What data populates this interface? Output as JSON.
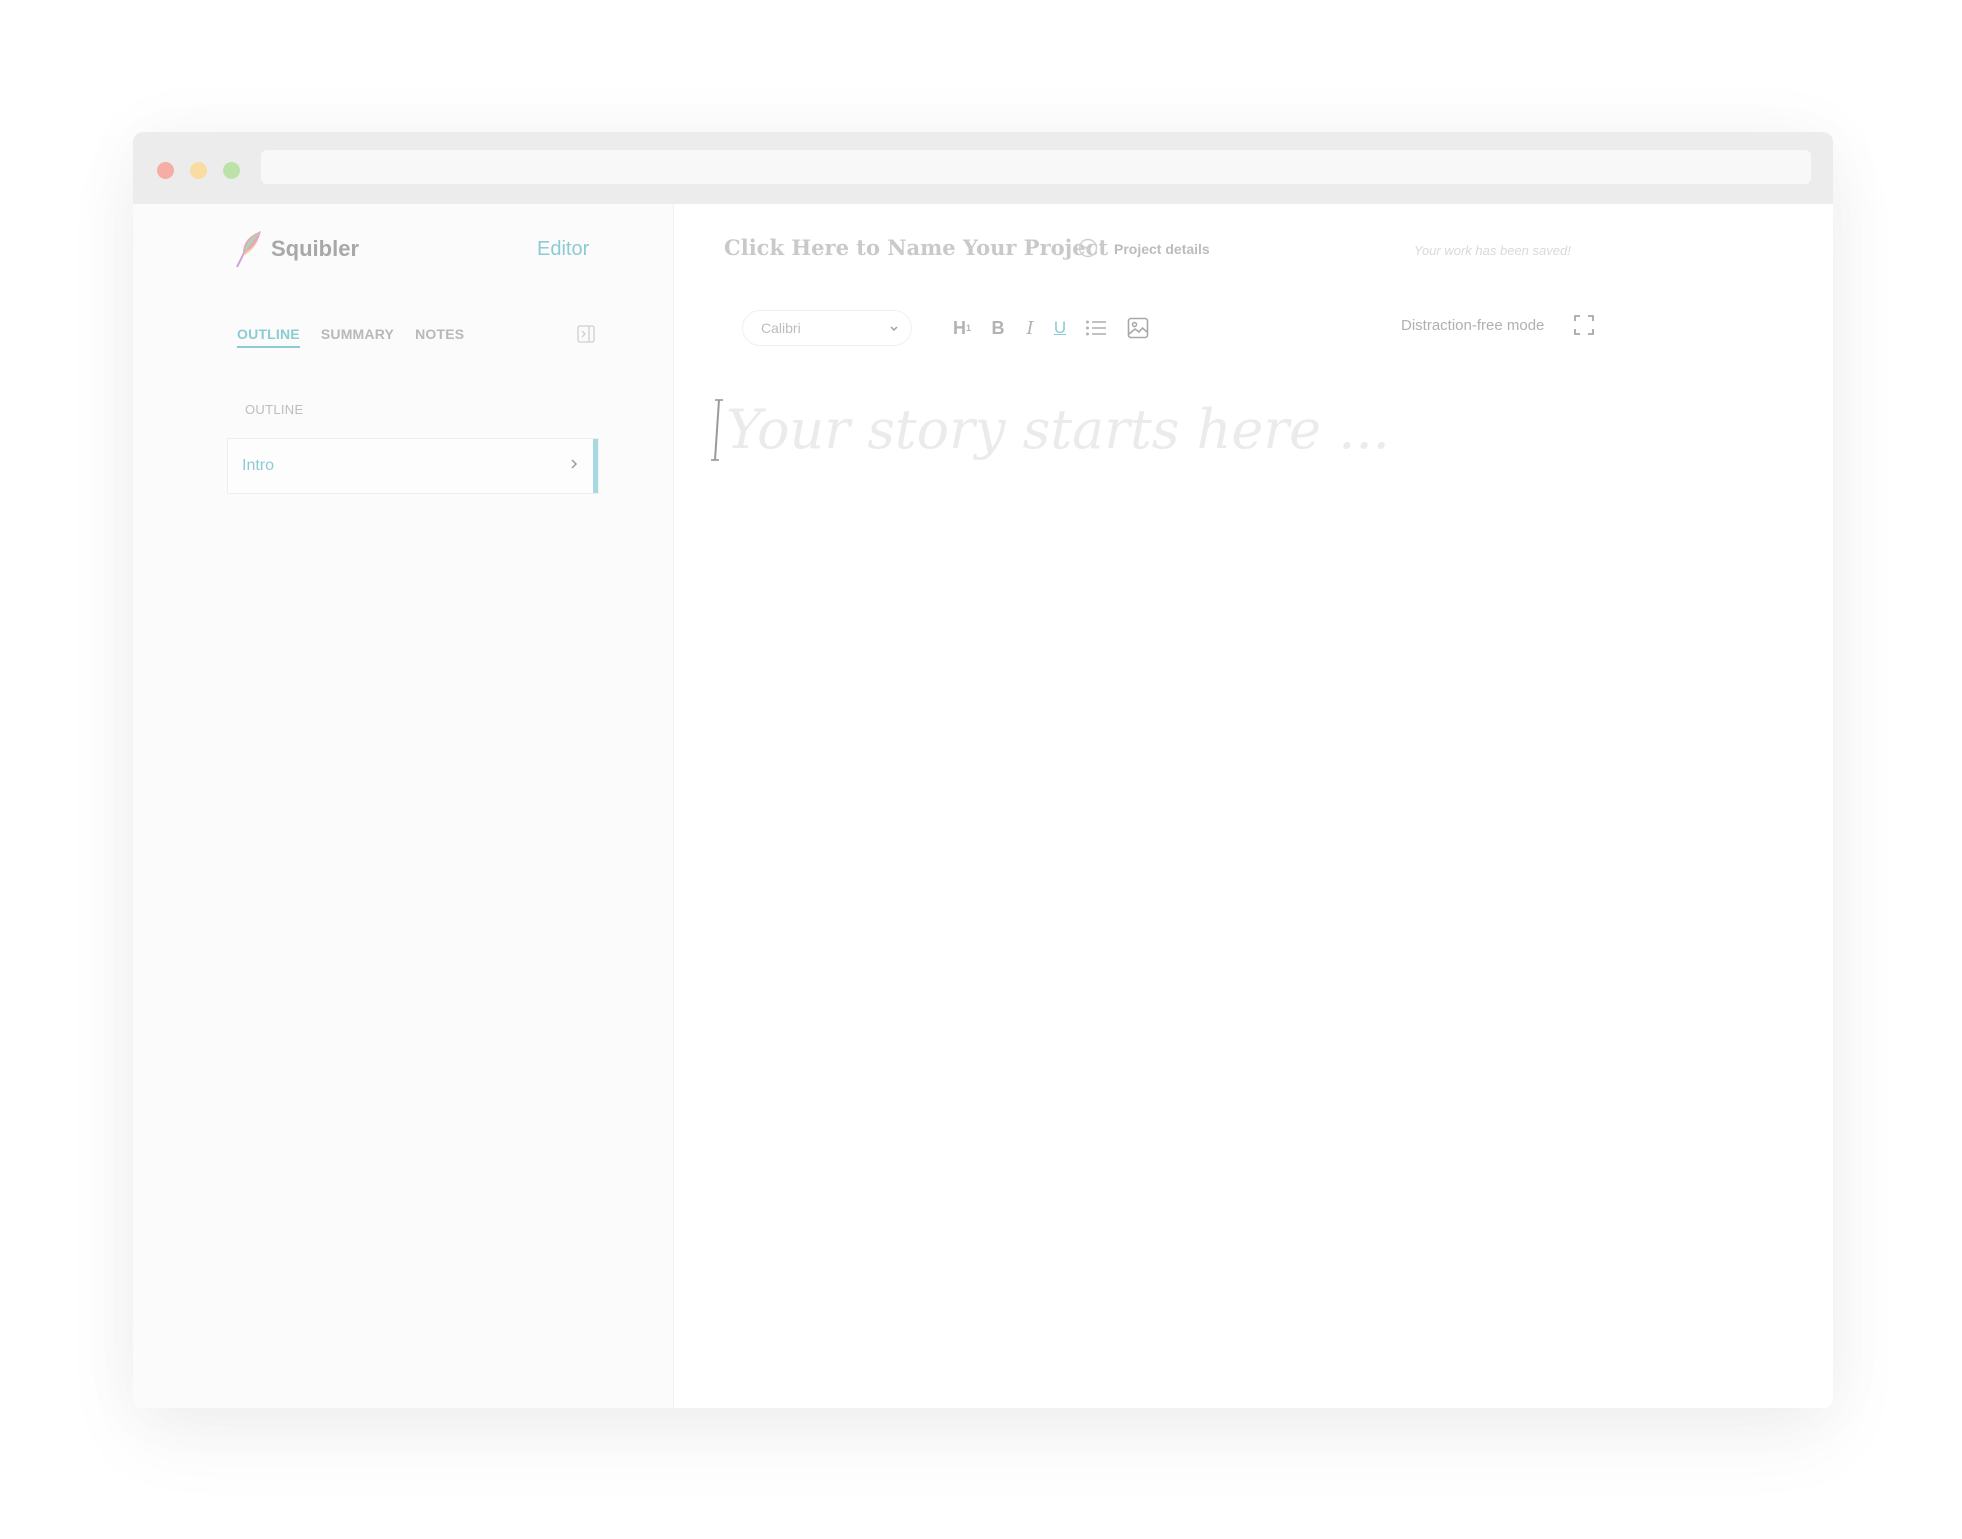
{
  "window": {
    "controls": [
      "close",
      "minimize",
      "maximize"
    ],
    "address_bar": ""
  },
  "sidebar": {
    "brand": "Squibler",
    "brand_icon": "feather-icon",
    "editor_link": "Editor",
    "tabs": [
      {
        "label": "OUTLINE",
        "active": true
      },
      {
        "label": "SUMMARY",
        "active": false
      },
      {
        "label": "NOTES",
        "active": false
      }
    ],
    "collapse_icon": "panel-collapse-icon",
    "section_label": "OUTLINE",
    "items": [
      {
        "label": "Intro",
        "selected": true
      }
    ]
  },
  "header": {
    "project_title": "Click Here to Name Your Project",
    "project_details": "Project details",
    "save_status": "Your work has been saved!"
  },
  "toolbar": {
    "font": "Calibri",
    "heading_label": "H",
    "heading_sub": "1",
    "bold_label": "B",
    "italic_label": "I",
    "underline_label": "U",
    "list_icon": "bulleted-list-icon",
    "image_icon": "image-icon",
    "distraction_free_label": "Distraction-free mode",
    "fullscreen_icon": "fullscreen-icon"
  },
  "editor": {
    "placeholder": "Your story starts here ..."
  },
  "colors": {
    "accent": "#8dcbd4",
    "muted_text": "#b3b3b3",
    "sidebar_bg": "#fbfbfb",
    "titlebar_bg": "#ececec"
  }
}
